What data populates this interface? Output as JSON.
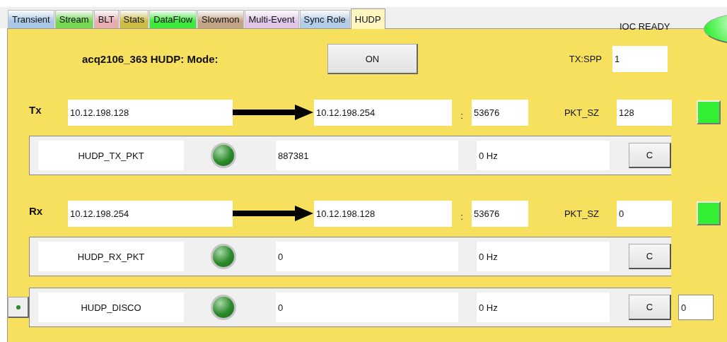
{
  "tabs": [
    {
      "label": "Transient",
      "color": "#a8c8ea",
      "selected": false
    },
    {
      "label": "Stream",
      "color": "#74d852",
      "selected": false
    },
    {
      "label": "BLT",
      "color": "#e6aeb0",
      "selected": false
    },
    {
      "label": "Stats",
      "color": "#cdbd45",
      "selected": false
    },
    {
      "label": "DataFlow",
      "color": "#3ee83e",
      "selected": false
    },
    {
      "label": "Slowmon",
      "color": "#c4a486",
      "selected": false
    },
    {
      "label": "Multi-Event",
      "color": "#e2c6ea",
      "selected": false
    },
    {
      "label": "Sync Role",
      "color": "#b2cdea",
      "selected": false
    },
    {
      "label": "HUDP",
      "color": "#fff6c0",
      "selected": true
    }
  ],
  "status": {
    "label": "IOC READY",
    "on": true
  },
  "mode": {
    "title": "acq2106_363 HUDP: Mode:",
    "button": "ON"
  },
  "tx_spp": {
    "label": "TX:SPP",
    "value": "1"
  },
  "links": [
    {
      "label": "Tx",
      "source": "10.12.198.128",
      "destination": "10.12.198.254",
      "separator": ":",
      "port": "53676",
      "size_label": "PKT_SZ",
      "size": "128",
      "on": true,
      "counter": {
        "name": "HUDP_TX_PKT",
        "on": true,
        "value": "887381",
        "rate": "0 Hz",
        "button": "C"
      }
    },
    {
      "label": "Rx",
      "source": "10.12.198.254",
      "destination": "10.12.198.128",
      "separator": ":",
      "port": "53676",
      "size_label": "PKT_SZ",
      "size": "0",
      "on": true,
      "counter": {
        "name": "HUDP_RX_PKT",
        "on": true,
        "value": "0",
        "rate": "0 Hz",
        "button": "C"
      }
    }
  ],
  "disco": {
    "counter": {
      "name": "HUDP_DISCO",
      "on": true,
      "value": "0",
      "rate": "0 Hz",
      "button": "C"
    },
    "value": "0"
  }
}
